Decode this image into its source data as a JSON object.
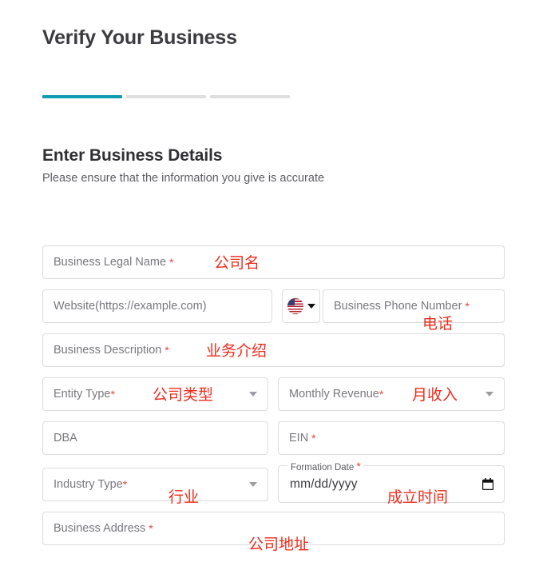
{
  "page": {
    "title": "Verify Your Business"
  },
  "stepper": {
    "steps": [
      {
        "state": "active"
      },
      {
        "state": "inactive"
      },
      {
        "state": "inactive"
      }
    ]
  },
  "section": {
    "heading": "Enter Business Details",
    "subheading": "Please ensure that the information you give is accurate"
  },
  "form": {
    "business_legal_name": {
      "placeholder": "Business Legal Name",
      "required_mark": "*",
      "annotation": "公司名"
    },
    "website": {
      "placeholder": "Website(https://example.com)"
    },
    "country_code": {
      "flag": "us-flag-icon",
      "caret": "chevron-down-icon"
    },
    "business_phone": {
      "placeholder": "Business Phone Number",
      "required_mark": "*",
      "annotation": "电话"
    },
    "business_description": {
      "placeholder": "Business Description",
      "required_mark": "*",
      "annotation": "业务介绍"
    },
    "entity_type": {
      "placeholder": "Entity Type",
      "required_mark": "*",
      "annotation": "公司类型"
    },
    "monthly_revenue": {
      "placeholder": "Monthly Revenue",
      "required_mark": "*",
      "annotation": "月收入"
    },
    "dba": {
      "placeholder": "DBA"
    },
    "ein": {
      "placeholder": "EIN",
      "required_mark": "*"
    },
    "industry_type": {
      "placeholder": "Industry Type",
      "required_mark": "*",
      "annotation": "行业"
    },
    "formation_date": {
      "label": "Formation Date",
      "required_mark": "*",
      "value": "mm/dd/yyyy",
      "annotation": "成立时间",
      "icon": "calendar-icon"
    },
    "business_address": {
      "placeholder": "Business Address",
      "required_mark": "*",
      "annotation": "公司地址"
    }
  },
  "colors": {
    "accent_teal": "#0d9cb0",
    "annotation_red": "#ee2b1b",
    "required_red": "#e8443a",
    "border_gray": "#dcdcdc",
    "placeholder_gray": "#78787e"
  }
}
